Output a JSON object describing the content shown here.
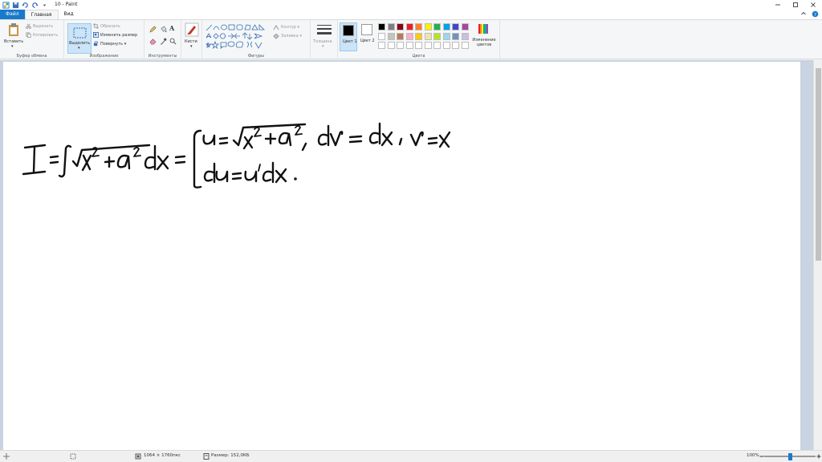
{
  "titlebar": {
    "title": "10 - Paint"
  },
  "tabs": {
    "file": "Файл",
    "home": "Главная",
    "view": "Вид"
  },
  "clipboard": {
    "paste": "Вставить",
    "cut": "Вырезать",
    "copy": "Копировать",
    "group": "Буфер обмена"
  },
  "image": {
    "select": "Выделить",
    "crop": "Обрезать",
    "resize": "Изменить размер",
    "rotate": "Повернуть",
    "group": "Изображение"
  },
  "tools": {
    "group": "Инструменты"
  },
  "brushes": {
    "label": "Кисти"
  },
  "shapes": {
    "group": "Фигуры",
    "outline": "Контур",
    "fill": "Заливка"
  },
  "size": {
    "label": "Толщина"
  },
  "colors": {
    "color1": "Цвет 1",
    "color2": "Цвет 2",
    "group": "Цвета",
    "edit": "Изменение цветов",
    "row1": [
      "#000000",
      "#7f7f7f",
      "#880015",
      "#ed1c24",
      "#ff7f27",
      "#fff200",
      "#22b14c",
      "#00a2e8",
      "#3f48cc",
      "#a349a4"
    ],
    "row2": [
      "#ffffff",
      "#c3c3c3",
      "#b97a57",
      "#ffaec9",
      "#ffc90e",
      "#efe4b0",
      "#b5e61d",
      "#99d9ea",
      "#7092be",
      "#c8bfe7"
    ]
  },
  "status": {
    "dimensions": "1064 × 1760пкс",
    "filesize": "Размер: 152,0КБ",
    "zoom": "100%"
  }
}
